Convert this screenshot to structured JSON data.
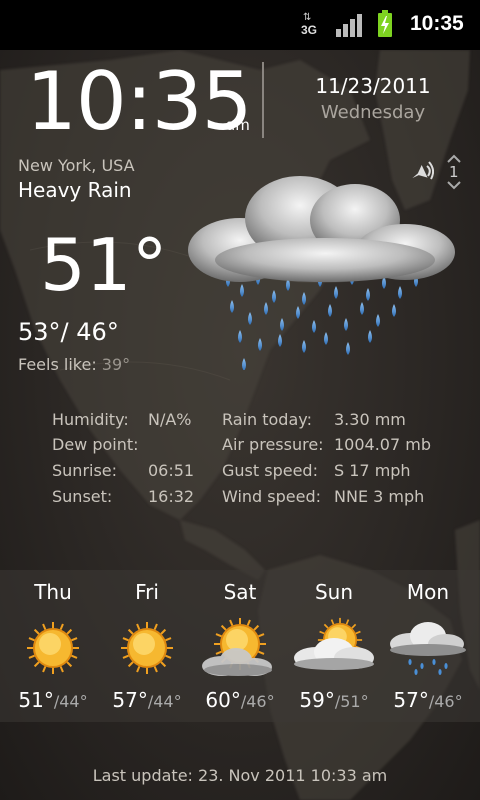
{
  "status_bar": {
    "network_label": "3G",
    "network_arrows": "⇅",
    "clock": "10:35",
    "battery_color": "#7ed321"
  },
  "clock": {
    "time": "10:35",
    "ampm": "am",
    "date": "11/23/2011",
    "weekday": "Wednesday"
  },
  "current": {
    "location": "New York, USA",
    "condition": "Heavy Rain",
    "icon": "heavy-rain-cloud-icon",
    "temperature": "51°",
    "high": "53°",
    "separator": "/",
    "low": "46°",
    "feels_like_label": "Feels like:",
    "feels_like_value": "39°",
    "page_number": "1"
  },
  "details": {
    "humidity_label": "Humidity:",
    "humidity_value": "N/A%",
    "dew_point_label": "Dew point:",
    "dew_point_value": "",
    "sunrise_label": "Sunrise:",
    "sunrise_value": "06:51",
    "sunset_label": "Sunset:",
    "sunset_value": "16:32",
    "rain_label": "Rain today:",
    "rain_value": "3.30 mm",
    "pressure_label": "Air pressure:",
    "pressure_value": "1004.07 mb",
    "gust_label": "Gust speed:",
    "gust_value": "S 17 mph",
    "wind_label": "Wind speed:",
    "wind_value": "NNE 3 mph"
  },
  "forecast": [
    {
      "day": "Thu",
      "icon": "sun-icon",
      "high": "51°",
      "low": "44°"
    },
    {
      "day": "Fri",
      "icon": "sun-icon",
      "high": "57°",
      "low": "44°"
    },
    {
      "day": "Sat",
      "icon": "partly-cloudy-icon",
      "high": "60°",
      "low": "46°"
    },
    {
      "day": "Sun",
      "icon": "sun-cloud-icon",
      "high": "59°",
      "low": "51°"
    },
    {
      "day": "Mon",
      "icon": "light-rain-cloud-icon",
      "high": "57°",
      "low": "46°"
    }
  ],
  "forecast_separator": "/",
  "footer": {
    "last_update": "Last update: 23. Nov 2011  10:33 am"
  },
  "colors": {
    "background": "#2b2724",
    "forecast_band": "#3c3834",
    "rain_drop": "#4a8fd6"
  }
}
